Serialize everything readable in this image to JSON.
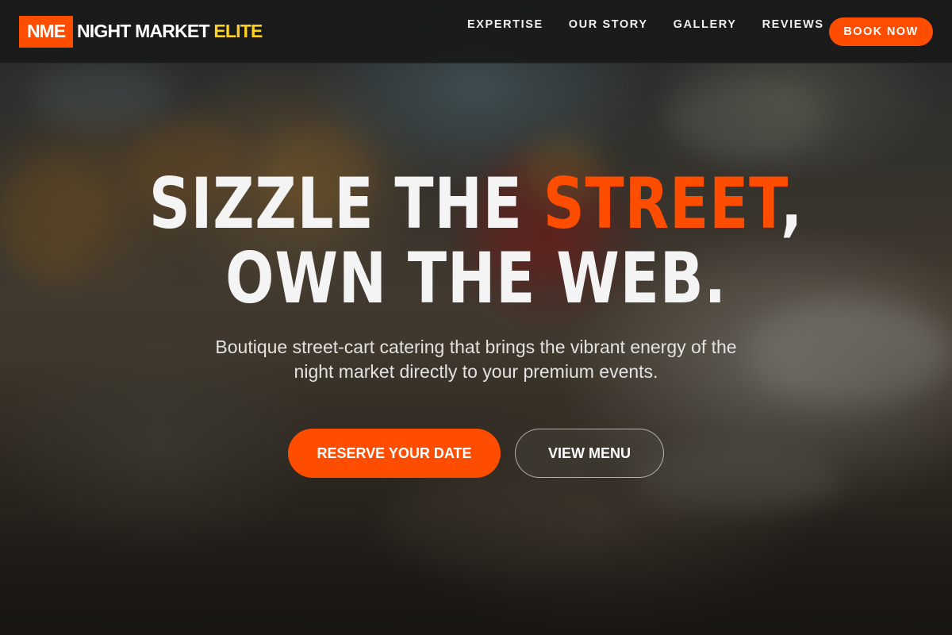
{
  "brand": {
    "badge": "NME",
    "name": "NIGHT MARKET",
    "accent": "ELITE"
  },
  "nav": {
    "items": [
      {
        "label": "EXPERTISE"
      },
      {
        "label": "OUR STORY"
      },
      {
        "label": "GALLERY"
      },
      {
        "label": "REVIEWS"
      }
    ],
    "cta_label": "BOOK NOW"
  },
  "hero": {
    "headline_line1_pre": "SIZZLE THE ",
    "headline_line1_highlight": "STREET",
    "headline_line1_post": ",",
    "headline_line2": "OWN THE WEB.",
    "subtitle": "Boutique street-cart catering that brings the vibrant energy of the night market directly to your premium events.",
    "primary_button": "RESERVE YOUR DATE",
    "secondary_button": "VIEW MENU"
  },
  "colors": {
    "accent": "#ff4d00",
    "brand_highlight": "#ffd21f",
    "header_bg": "#1a1a1a"
  }
}
